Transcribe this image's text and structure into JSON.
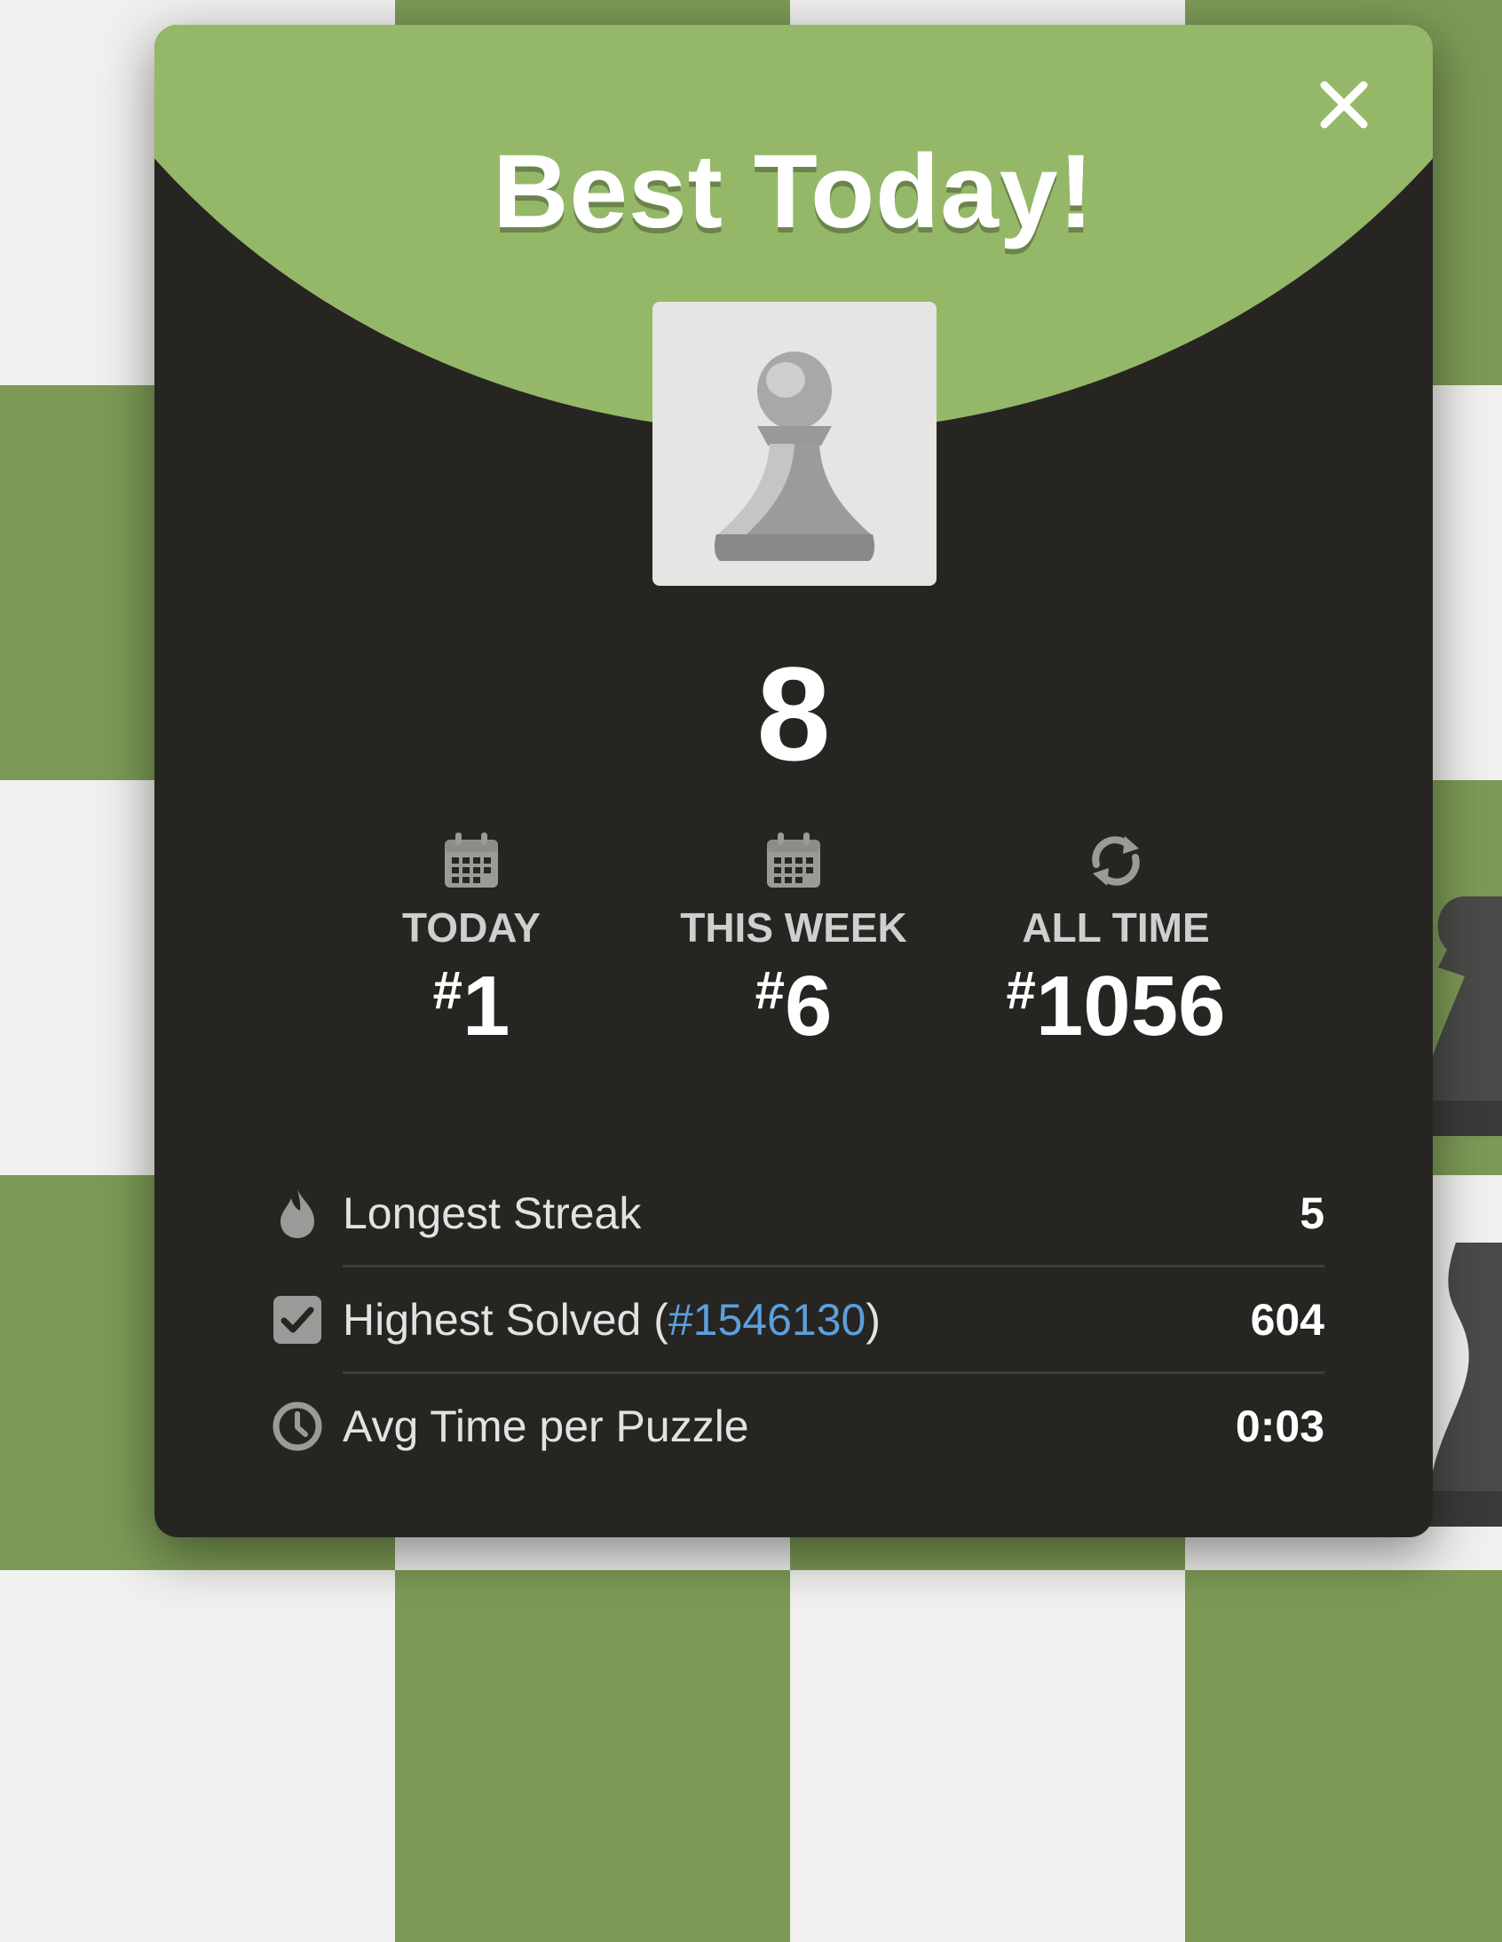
{
  "modal": {
    "title": "Best Today!",
    "close_icon": "close-icon",
    "avatar_icon": "pawn-icon",
    "score": "8",
    "colors": {
      "header_green": "#95b868",
      "panel_dark": "#262522",
      "link_blue": "#5d9fdb"
    }
  },
  "ranks": [
    {
      "label": "TODAY",
      "hash": "#",
      "value": "1",
      "icon": "calendar-icon"
    },
    {
      "label": "THIS WEEK",
      "hash": "#",
      "value": "6",
      "icon": "calendar-icon"
    },
    {
      "label": "ALL TIME",
      "hash": "#",
      "value": "1056",
      "icon": "refresh-icon"
    }
  ],
  "stats": {
    "longest_streak": {
      "label": "Longest Streak",
      "value": "5",
      "icon": "flame-icon"
    },
    "highest_solved": {
      "label_prefix": "Highest Solved (",
      "link": "#1546130",
      "label_suffix": ")",
      "value": "604",
      "icon": "checkbox-icon"
    },
    "avg_time": {
      "label": "Avg Time per Puzzle",
      "value": "0:03",
      "icon": "clock-icon"
    }
  }
}
